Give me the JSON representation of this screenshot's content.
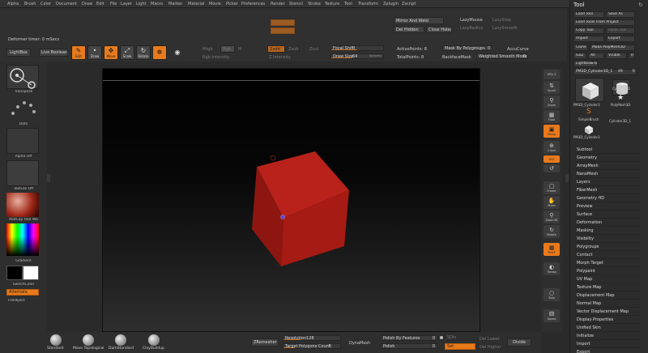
{
  "menu": [
    "Alpha",
    "Brush",
    "Color",
    "Document",
    "Draw",
    "Edit",
    "File",
    "Layer",
    "Light",
    "Macro",
    "Marker",
    "Material",
    "Movie",
    "Picker",
    "Preferences",
    "Render",
    "Stencil",
    "Stroke",
    "Texture",
    "Tool",
    "Transform",
    "Zplugin",
    "Zscript"
  ],
  "status": {
    "deformer_timer": "Deformer timer: 0 mSecs"
  },
  "top": {
    "lightbox": "LightBox",
    "live_boolean": "Live Boolean",
    "edit": "Edit",
    "draw": "Draw",
    "move": "Move",
    "scale": "Scale",
    "rotate": "Rotate",
    "mrgb": "Mrgb",
    "rgb": "Rgb",
    "m": "M",
    "zadd": "Zadd",
    "zsub": "Zsub",
    "zcut": "Zcut",
    "rgb_intensity": "Rgb Intensity",
    "z_intensity": "Z Intensity",
    "focal_shift": "Focal Shift",
    "focal_shift_val": "0",
    "draw_size": "Draw Size",
    "draw_size_val": "64",
    "dynamic": "Dynamic",
    "active_points": "ActivePoints: 8",
    "total_points": "TotalPoints: 8",
    "mirror_weld": "Mirror And Weld",
    "del_hidden": "Del Hidden",
    "close_holes": "Close Holes",
    "lazy_mouse": "LazyMouse",
    "lazy_step": "LazyStep",
    "lazy_radius": "LazyRadius",
    "lazy_smooth": "LazySmooth",
    "mask_by_polygroups": "Mask By Polygroups",
    "mask_by_polygroups_val": "0",
    "backface_mask": "BackfaceMask",
    "weighted_smooth_mode": "Weighted Smooth Mode",
    "weighted_smooth_mode_val": "0",
    "accu_curve": "AccuCurve",
    "mrgb_dim": "Mrgb",
    "rgb_dim": "Rgb",
    "zadd_label": "Zadd"
  },
  "left": {
    "transpose": "Transpose",
    "dots": "Dots",
    "alpha_off": "Alpha Off",
    "texture_off": "Texture Off",
    "matcap": "MatCap Red Wa",
    "gradient": "Gradient",
    "switch_color": "SwitchColor",
    "alternate": "Alternate",
    "fill_object": "FillObject"
  },
  "right": {
    "spix": "SPix",
    "spix_val": "3",
    "scroll": "Scroll",
    "zoom": "Zoom",
    "actual": "Actual",
    "aahalf": "AAHalf",
    "persp": "Persp",
    "floor": "Floor",
    "local": "L.Sym",
    "xyz": "XYZ",
    "frame": "Frame",
    "move": "Move",
    "zoom3d": "Zoom3D",
    "rotate": "Rotate",
    "line_fill": "Line Fill",
    "polyf": "PolyF",
    "transp": "Transp",
    "ghost": "Ghost",
    "solo": "Solo",
    "xpose": "Xpose"
  },
  "tool": {
    "title": "Tool",
    "load_tool": "Load Tool",
    "save_as": "Save As",
    "load_from_project": "Load Tools From Project",
    "copy_tool": "Copy Tool",
    "paste_tool": "Paste Tool",
    "import": "Import",
    "export": "Export",
    "clone": "Clone",
    "make_polymesh": "Make PolyMesh3D",
    "goz": "GoZ",
    "all": "All",
    "visible": "Visible",
    "r": "R",
    "lightbox_tools": "Lightbox▸Tools",
    "current_tool": "PM3D_Cylinder3D_1",
    "current_val": "49",
    "r2": "R",
    "thumbs": [
      "PM3D_Cylinder3",
      "Cylinder3D",
      "PolyMesh3D",
      "SimpleBrush",
      "Cylinder3D_1",
      "PM3D_Cylinder3"
    ],
    "subpalettes": [
      "Subtool",
      "Geometry",
      "ArrayMesh",
      "NanoMesh",
      "Layers",
      "FiberMesh",
      "Geometry HD",
      "Preview",
      "Surface",
      "Deformation",
      "Masking",
      "Visibility",
      "Polygroups",
      "Contact",
      "Morph Target",
      "Polypaint",
      "UV Map",
      "Texture Map",
      "Displacement Map",
      "Normal Map",
      "Vector Displacement Map",
      "Display Properties",
      "Unified Skin",
      "Initialize",
      "Import",
      "Export"
    ]
  },
  "bottom": {
    "brushes": [
      "Standard",
      "Move Topological",
      "DamStandard",
      "ClayBuildup"
    ],
    "zremesher": "ZRemesher",
    "resolution": "Resolution",
    "resolution_val": "128",
    "target_polygons": "Target Polygons Count",
    "target_polygons_val": "5",
    "dynamesh": "DynaMesh",
    "polish_features": "Polish By Features",
    "polish_features_val": "0",
    "polish": "Polish",
    "polish_val": "0",
    "set": "Set",
    "del_lower": "Del Lower",
    "del_higher": "Del Higher",
    "divide": "Divide",
    "sdiv": "SDiv"
  }
}
